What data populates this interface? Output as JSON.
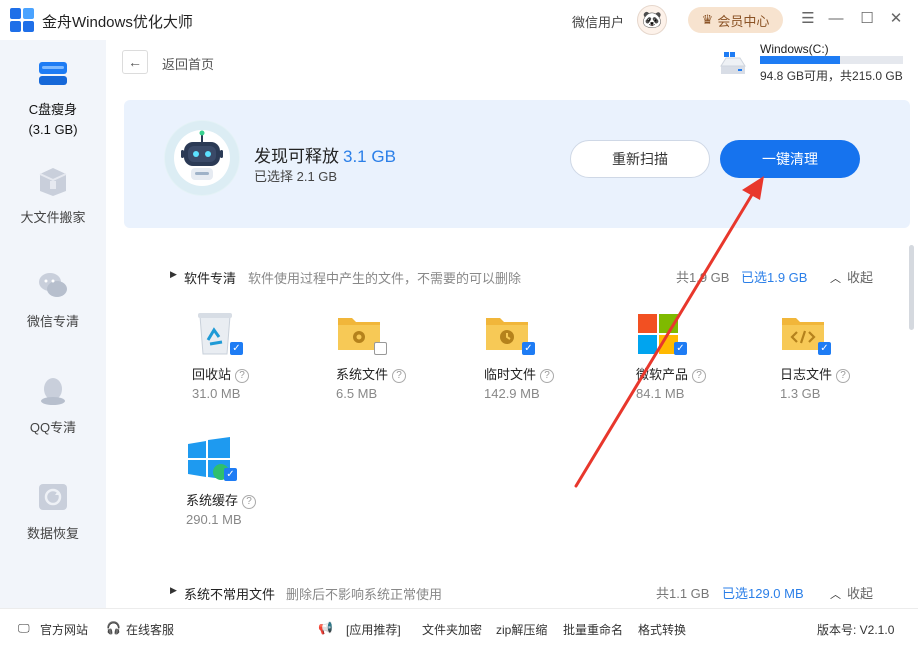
{
  "app": {
    "title": "金舟Windows优化大师",
    "user_name": "微信用户",
    "vip_label": "会员中心"
  },
  "sidebar": {
    "items": [
      {
        "label": "C盘瘦身",
        "sub": "(3.1 GB)",
        "icon": "disk-icon"
      },
      {
        "label": "大文件搬家",
        "icon": "box-icon"
      },
      {
        "label": "微信专清",
        "icon": "wechat-icon"
      },
      {
        "label": "QQ专清",
        "icon": "qq-icon"
      },
      {
        "label": "数据恢复",
        "icon": "restore-icon"
      }
    ]
  },
  "header": {
    "back_label": "返回首页",
    "disk": {
      "name": "Windows(C:)",
      "info": "94.8 GB可用，共215.0 GB",
      "used_fraction": 0.56
    }
  },
  "summary": {
    "found_label": "发现可释放",
    "found_value": "3.1 GB",
    "selected_label": "已选择 2.1 GB",
    "rescan_label": "重新扫描",
    "clean_label": "一键清理"
  },
  "sections": [
    {
      "title": "软件专清",
      "desc": "软件使用过程中产生的文件，不需要的可以删除",
      "total": "共1.9 GB",
      "selected": "已选1.9 GB",
      "collapse": "收起",
      "items": [
        {
          "name": "回收站",
          "size": "31.0 MB",
          "checked": true,
          "icon": "recycle-bin-icon"
        },
        {
          "name": "系统文件",
          "size": "6.5 MB",
          "checked": false,
          "icon": "settings-folder-icon"
        },
        {
          "name": "临时文件",
          "size": "142.9 MB",
          "checked": true,
          "icon": "clock-folder-icon"
        },
        {
          "name": "微软产品",
          "size": "84.1 MB",
          "checked": true,
          "icon": "microsoft-icon"
        },
        {
          "name": "日志文件",
          "size": "1.3 GB",
          "checked": true,
          "icon": "code-folder-icon"
        },
        {
          "name": "系统缓存",
          "size": "290.1 MB",
          "checked": true,
          "icon": "windows-icon"
        }
      ]
    },
    {
      "title": "系统不常用文件",
      "desc": "删除后不影响系统正常使用",
      "total": "共1.1 GB",
      "selected": "已选129.0 MB",
      "collapse": "收起"
    }
  ],
  "bottom": {
    "website": "官方网站",
    "service": "在线客服",
    "recommend": "[应用推荐]",
    "links": [
      "文件夹加密",
      "zip解压缩",
      "批量重命名",
      "格式转换"
    ],
    "version": "版本号: V2.1.0"
  },
  "colors": {
    "accent": "#1673ee",
    "annotation": "#e8372c"
  }
}
